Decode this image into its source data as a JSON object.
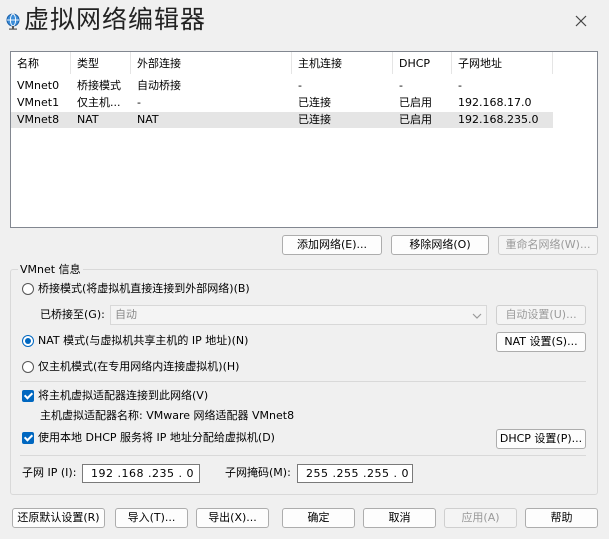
{
  "window": {
    "title": "虚拟网络编辑器"
  },
  "table": {
    "columns": [
      "名称",
      "类型",
      "外部连接",
      "主机连接",
      "DHCP",
      "子网地址"
    ],
    "rows": [
      {
        "name": "VMnet0",
        "type": "桥接模式",
        "external": "自动桥接",
        "host": "-",
        "dhcp": "-",
        "subnet": "-"
      },
      {
        "name": "VMnet1",
        "type": "仅主机...",
        "external": "-",
        "host": "已连接",
        "dhcp": "已启用",
        "subnet": "192.168.17.0"
      },
      {
        "name": "VMnet8",
        "type": "NAT",
        "external": "NAT",
        "host": "已连接",
        "dhcp": "已启用",
        "subnet": "192.168.235.0"
      }
    ],
    "selected_row": 2
  },
  "list_buttons": {
    "add": "添加网络(E)...",
    "remove": "移除网络(O)",
    "rename": "重命名网络(W)..."
  },
  "vmnet_info": {
    "group_label": "VMnet 信息",
    "bridge_mode": "桥接模式(将虚拟机直接连接到外部网络)(B)",
    "bridged_to_label": "已桥接至(G):",
    "bridged_to_value": "自动",
    "auto_settings": "自动设置(U)...",
    "nat_mode": "NAT 模式(与虚拟机共享主机的 IP 地址)(N)",
    "nat_settings": "NAT 设置(S)...",
    "host_only_mode": "仅主机模式(在专用网络内连接虚拟机)(H)",
    "connect_adapter": "将主机虚拟适配器连接到此网络(V)",
    "adapter_name": "主机虚拟适配器名称: VMware 网络适配器 VMnet8",
    "use_dhcp": "使用本地 DHCP 服务将 IP 地址分配给虚拟机(D)",
    "dhcp_settings": "DHCP 设置(P)...",
    "subnet_ip_label": "子网 IP (I):",
    "subnet_ip_value": "192 .168 .235 . 0",
    "subnet_mask_label": "子网掩码(M):",
    "subnet_mask_value": "255 .255 .255 . 0",
    "selected_mode": "nat"
  },
  "footer": {
    "restore": "还原默认设置(R)",
    "import": "导入(T)...",
    "export": "导出(X)...",
    "ok": "确定",
    "cancel": "取消",
    "apply": "应用(A)",
    "help": "帮助"
  },
  "colors": {
    "accent": "#0067c0",
    "selected_row": "#e5e5e5"
  }
}
